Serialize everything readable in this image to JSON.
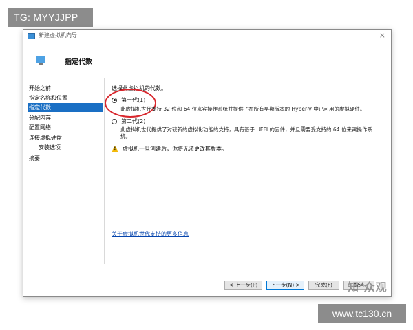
{
  "watermark": {
    "top_left": "TG: MYYJJPP",
    "bottom_right": "www.tc130.cn",
    "mid_overlay": "知 众观"
  },
  "window": {
    "title": "新建虚拟机向导",
    "close_glyph": "×",
    "header_title": "指定代数"
  },
  "sidebar": {
    "items": [
      {
        "label": "开始之前"
      },
      {
        "label": "指定名称和位置"
      },
      {
        "label": "指定代数"
      },
      {
        "label": "分配内存"
      },
      {
        "label": "配置网络"
      },
      {
        "label": "连接虚拟硬盘"
      },
      {
        "label": "安装选项"
      },
      {
        "label": "摘要"
      }
    ],
    "selected_index": 2
  },
  "content": {
    "prompt": "选择此虚拟机的代数。",
    "options": [
      {
        "label": "第一代(1)",
        "checked": true,
        "description": "此虚拟机世代支持 32 位和 64 位来宾操作系统并提供了在所有早期版本的 Hyper-V 中已可用的虚拟硬件。"
      },
      {
        "label": "第二代(2)",
        "checked": false,
        "description": "此虚拟机世代提供了对较新的虚拟化功能的支持，具有基于 UEFI 的固件，并且需要受支持的 64 位来宾操作系统。"
      }
    ],
    "warning": "虚拟机一旦创建后，你将无法更改其版本。",
    "more_info_link": "关于虚拟机世代支持的更多信息"
  },
  "footer": {
    "prev": "< 上一步(P)",
    "next": "下一步(N) >",
    "finish": "完成(F)",
    "cancel": "取消"
  },
  "colors": {
    "selection": "#1a6fc4",
    "annotation": "#d8262c",
    "warning": "#f2b90a",
    "link": "#0645ad"
  }
}
